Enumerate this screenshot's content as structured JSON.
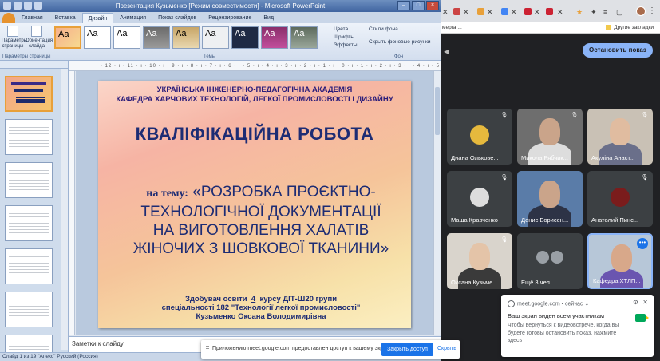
{
  "powerpoint": {
    "title": "Презентация Кузьменко [Режим совместимости] - Microsoft PowerPoint",
    "tabs": [
      "Главная",
      "Вставка",
      "Дизайн",
      "Анимация",
      "Показ слайдов",
      "Рецензирование",
      "Вид"
    ],
    "active_tab": "Дизайн",
    "ribbon": {
      "page_setup_label": "Параметры страницы",
      "orientation_label": "Ориентация слайда",
      "group_page": "Параметры страницы",
      "group_themes": "Темы",
      "group_bg": "Фон",
      "theme_sample": "Aa",
      "colors": "Цвета",
      "fonts": "Шрифты",
      "effects": "Эффекты",
      "bg_styles": "Стили фона",
      "hide_bg": "Скрыть фоновые рисунки"
    },
    "ruler_text": "· 12 · ı · 11 · ı · 10 · ı · 9 · ı · 8 · ı · 7 · ı · 6 · ı · 5 · ı · 4 · ı · 3 · ı · 2 · ı · 1 · ı · 0 · ı · 1 · ı · 2 · ı · 3 · ı · 4 · ı · 5 · ı · 6 · ı · 7 · ı · 8 · ı · 9 · ı · 10 · ı · 11 · ı · 12 ·",
    "slide": {
      "institution_1": "УКРАЇНСЬКА ІНЖЕНЕРНО-ПЕДАГОГІЧНА АКАДЕМІЯ",
      "institution_2": "КАФЕДРА ХАРЧОВИХ ТЕХНОЛОГІЙ, ЛЕГКОЇ ПРОМИСЛОВОСТІ І ДИЗАЙНУ",
      "heading": "КВАЛІФІКАЦІЙНА РОБОТА",
      "topic_lead": "на тему:",
      "topic_1": "«РОЗРОБКА ПРОЄКТНО-",
      "topic_2": "ТЕХНОЛОГІЧНОЇ ДОКУМЕНТАЦІЇ",
      "topic_3": "НА ВИГОТОВЛЕННЯ ХАЛАТІВ",
      "topic_4": "ЖІНОЧИХ З ШОВКОВОЇ ТКАНИНИ»",
      "author_1a": "Здобувач освіти",
      "author_1b": "4",
      "author_1c": "курсу ДІТ-Ш20 групи",
      "author_2a": "спеціальності",
      "author_2b": "182 \"Технології легкої промисловості\"",
      "author_3": "Кузьменко Оксана Володимирівна"
    },
    "notes_placeholder": "Заметки к слайду",
    "status": "Слайд 1 из 19   \"Апекс\"   Русский (Россия)"
  },
  "chrome": {
    "bookmark_left": "мерга ...",
    "bookmark_right": "Другие закладки"
  },
  "meet": {
    "stop_share": "Остановить показ",
    "participants": [
      {
        "name": "Диана Олькове...",
        "color": "#e6b93d"
      },
      {
        "name": "Микола Рябчик...",
        "video": true
      },
      {
        "name": "Акуліна Анаст...",
        "video": true
      },
      {
        "name": "Маша Кравченко",
        "color": "#dddddd"
      },
      {
        "name": "Денис Борисен...",
        "video": true
      },
      {
        "name": "Анатолий Пинс...",
        "color": "#7a1c1c"
      },
      {
        "name": "Оксана Кузьме...",
        "video": true
      },
      {
        "name": "Ещё 3 чел."
      },
      {
        "name": "Кафедра ХТЛП...",
        "video": true
      }
    ],
    "share_msg": "Приложению meet.google.com предоставлен доступ к вашему экрану.",
    "share_stop": "Закрыть доступ",
    "share_hide": "Скрыть"
  },
  "notification": {
    "source": "meet.google.com • сейчас ⌄",
    "title": "Ваш экран виден всем участникам",
    "body": "Чтобы вернуться к видеовстрече, когда вы будете готовы остановить показ, нажмите здесь"
  }
}
